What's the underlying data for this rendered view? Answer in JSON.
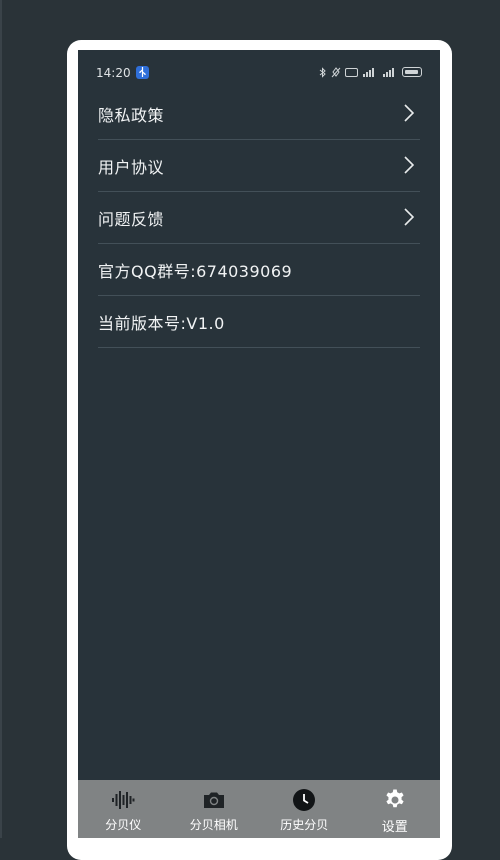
{
  "status_bar": {
    "time": "14:20"
  },
  "menu": {
    "items": [
      {
        "label": "隐私政策",
        "has_arrow": true
      },
      {
        "label": "用户协议",
        "has_arrow": true
      },
      {
        "label": "问题反馈",
        "has_arrow": true
      },
      {
        "label": "官方QQ群号:674039069",
        "has_arrow": false
      },
      {
        "label": "当前版本号:V1.0",
        "has_arrow": false
      }
    ]
  },
  "tabbar": {
    "tabs": [
      {
        "label": "分贝仪",
        "icon": "waveform-icon"
      },
      {
        "label": "分贝相机",
        "icon": "camera-icon"
      },
      {
        "label": "历史分贝",
        "icon": "clock-icon"
      },
      {
        "label": "设置",
        "icon": "gear-icon",
        "active": true
      }
    ]
  },
  "colors": {
    "background": "#2a3338",
    "screen": "#28333a",
    "divider": "#435058",
    "tabbar": "#808384",
    "usb_badge": "#2f6fd9"
  }
}
